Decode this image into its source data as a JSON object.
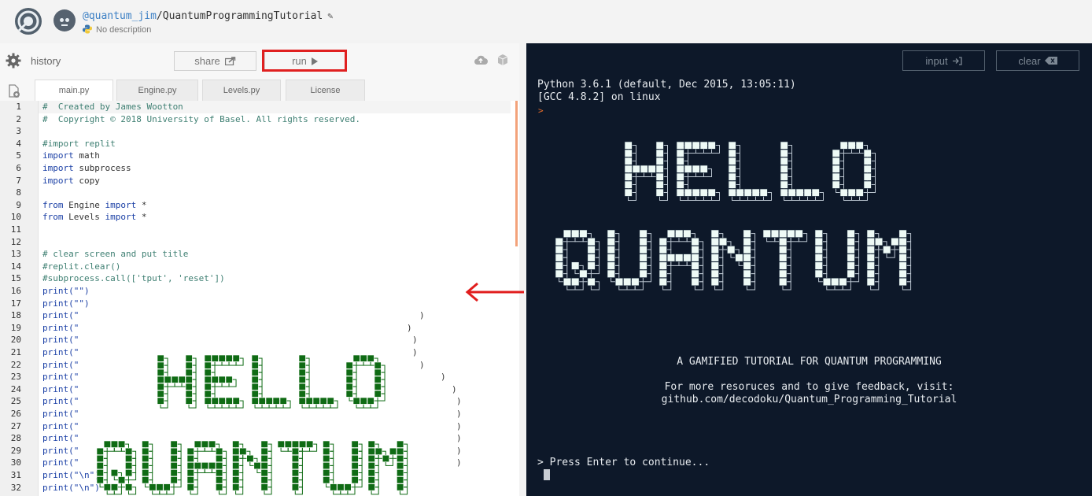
{
  "header": {
    "user": "@quantum_jim",
    "separator": "/",
    "repo": "QuantumProgrammingTutorial",
    "description": "No description"
  },
  "toolbar": {
    "history_label": "history",
    "share_label": "share",
    "run_label": "run"
  },
  "tabs": [
    {
      "label": "main.py",
      "active": true
    },
    {
      "label": "Engine.py",
      "active": false
    },
    {
      "label": "Levels.py",
      "active": false
    },
    {
      "label": "License",
      "active": false
    }
  ],
  "editor": {
    "line_numbers": [
      "1",
      "2",
      "3",
      "4",
      "5",
      "6",
      "7",
      "8",
      "9",
      "10",
      "11",
      "12",
      "13",
      "14",
      "15",
      "16",
      "17",
      "18",
      "19",
      "20",
      "21",
      "22",
      "23",
      "24",
      "25",
      "26",
      "27",
      "28",
      "29",
      "30",
      "31",
      "32"
    ],
    "lines": {
      "l1": "#  Created by James Wootton",
      "l2": "#  Copyright © 2018 University of Basel. All rights reserved.",
      "l4": "#import replit",
      "l5_kw": "import",
      "l5_rest": " math",
      "l6_kw": "import",
      "l6_rest": " subprocess",
      "l7_kw": "import",
      "l7_rest": " copy",
      "l9_kw1": "from",
      "l9_mid": " Engine ",
      "l9_kw2": "import",
      "l9_rest": " *",
      "l10_kw1": "from",
      "l10_mid": " Levels ",
      "l10_kw2": "import",
      "l10_rest": " *",
      "l13": "# clear screen and put title",
      "l14": "#replit.clear()",
      "l15": "#subprocess.call(['tput', 'reset'])",
      "l16": "print(\"\")",
      "l17": "print(\"\")",
      "print_open": "print(\"",
      "l31": "print(\"\\n\")",
      "l32": "print(\"\\n\")"
    },
    "closers": [
      ")",
      ")",
      ")",
      ")",
      ")",
      ")",
      ")",
      ")",
      ")",
      ")",
      ")",
      ")",
      ")"
    ]
  },
  "console": {
    "input_label": "input",
    "clear_label": "clear",
    "line1": "Python 3.6.1 (default, Dec 2015, 13:05:11)",
    "line2": "[GCC 4.8.2] on linux",
    "prompt_mark": ">",
    "banner_title_1": "HELLO",
    "banner_title_2": "QUANTUM",
    "subtitle": "A GAMIFIED TUTORIAL FOR QUANTUM PROGRAMMING",
    "feedback": "For more resoruces and to give feedback, visit:",
    "link": "github.com/decodoku/Quantum_Programming_Tutorial",
    "press_enter": "> Press Enter to continue..."
  }
}
